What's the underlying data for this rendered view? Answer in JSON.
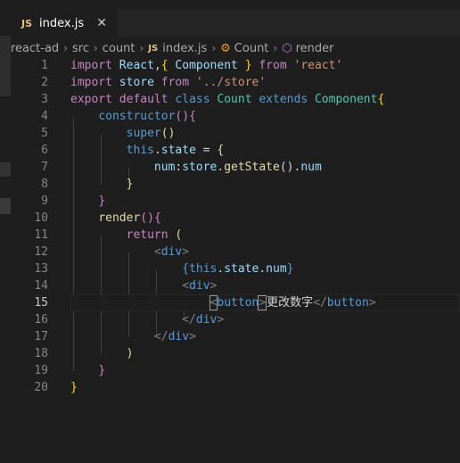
{
  "tab": {
    "icon": "js-file-icon",
    "badge": "JS",
    "filename": "index.js",
    "close": "✕"
  },
  "breadcrumb": {
    "items": [
      "react-ad",
      "src",
      "count",
      "index.js",
      "Count",
      "render"
    ],
    "js_badge": "JS"
  },
  "editor": {
    "line_numbers": [
      "1",
      "2",
      "3",
      "4",
      "5",
      "6",
      "7",
      "8",
      "9",
      "10",
      "11",
      "12",
      "13",
      "14",
      "15",
      "16",
      "17",
      "18",
      "19",
      "20"
    ],
    "current_line": 15,
    "lines": [
      "import React,{ Component } from 'react'",
      "import store from '../store'",
      "export default class Count extends Component{",
      "    constructor(){",
      "        super()",
      "        this.state = {",
      "            num:store.getState().num",
      "        }",
      "    }",
      "    render(){",
      "        return (",
      "            <div>",
      "                {this.state.num}",
      "                <div>",
      "                    <button>更改数字</button>",
      "                </div>",
      "            </div>",
      "        )",
      "    }",
      "}"
    ],
    "tokens": {
      "import": "import",
      "from": "from",
      "export": "export",
      "default": "default",
      "class": "class",
      "extends": "extends",
      "return": "return",
      "React": "React",
      "Component": "Component",
      "store": "store",
      "Count": "Count",
      "react_str": "'react'",
      "store_str": "'../store'",
      "constructor": "constructor",
      "super": "super",
      "this": "this",
      "state": "state",
      "num": "num",
      "getState": "getState",
      "render": "render",
      "div": "div",
      "button": "button",
      "button_text": "更改数字"
    }
  },
  "colors": {
    "background": "#1e1e1e",
    "keyword": "#c586c0",
    "storage": "#569cd6",
    "variable": "#9cdcfe",
    "type": "#4ec9b0",
    "string": "#ce9178",
    "function": "#dcdcaa"
  }
}
